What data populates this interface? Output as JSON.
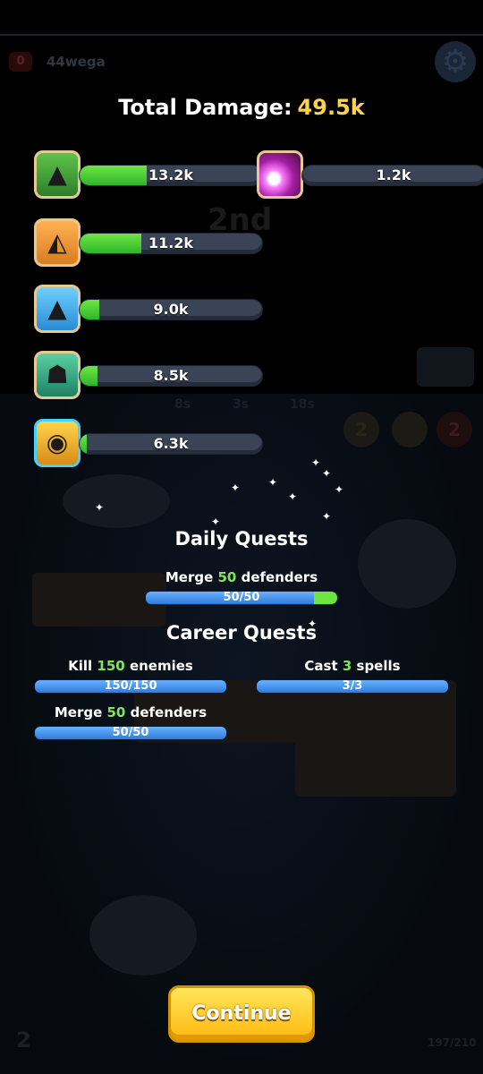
{
  "header": {
    "score_badge": "0",
    "player_name": "44wega"
  },
  "summary": {
    "label": "Total Damage:",
    "value": "49.5k",
    "rank_ghost": "2nd"
  },
  "damage": [
    {
      "name": "green-hooded-mage",
      "value": "13.2k",
      "fill": 0.37,
      "portrait": "green"
    },
    {
      "name": "straw-hat-mage",
      "value": "11.2k",
      "fill": 0.34,
      "portrait": "orange"
    },
    {
      "name": "ice-mage",
      "value": "9.0k",
      "fill": 0.11,
      "portrait": "blue"
    },
    {
      "name": "teal-mage",
      "value": "8.5k",
      "fill": 0.1,
      "portrait": "teal"
    },
    {
      "name": "goggles-mage",
      "value": "6.3k",
      "fill": 0.04,
      "portrait": "cyanframe"
    },
    {
      "name": "magic-spell",
      "value": "1.2k",
      "fill": 0.0,
      "portrait": "purple"
    }
  ],
  "timers": [
    "8s",
    "3s",
    "18s"
  ],
  "daily": {
    "title": "Daily Quests",
    "quests": [
      {
        "pre": "Merge ",
        "num": "50",
        "post": " defenders",
        "progress": "50/50",
        "fraction": 1.0
      }
    ]
  },
  "career": {
    "title": "Career Quests",
    "quests": [
      {
        "pre": "Kill ",
        "num": "150",
        "post": " enemies",
        "progress": "150/150",
        "fraction": 1.0
      },
      {
        "pre": "Cast ",
        "num": "3",
        "post": " spells",
        "progress": "3/3",
        "fraction": 1.0
      },
      {
        "pre": "Merge ",
        "num": "50",
        "post": " defenders",
        "progress": "50/50",
        "fraction": 1.0
      }
    ]
  },
  "continue_label": "Continue",
  "footer": {
    "counter": "197/210",
    "left_num": "2"
  },
  "side_badges": [
    "2",
    "2"
  ],
  "colors": {
    "gold": "#ffd24a",
    "green": "#6fe546",
    "quest_blue": "#2f7bd8",
    "button": "#ffd02a"
  }
}
